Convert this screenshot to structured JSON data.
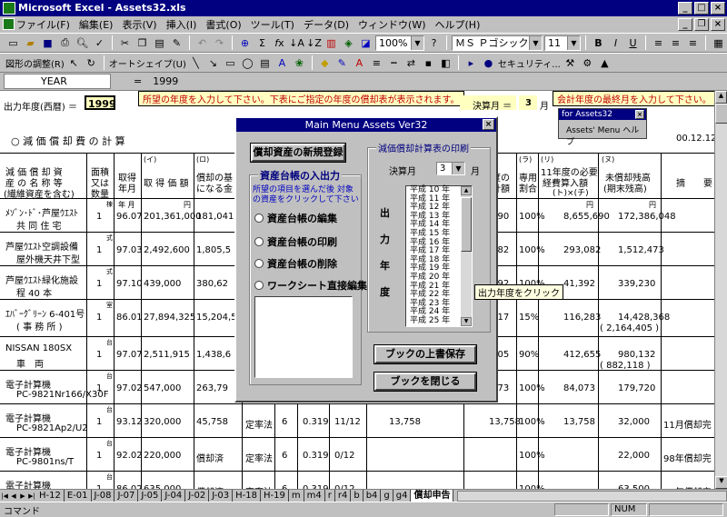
{
  "window": {
    "title": "Microsoft Excel - Assets32.xls"
  },
  "menu": [
    "ファイル(F)",
    "編集(E)",
    "表示(V)",
    "挿入(I)",
    "書式(O)",
    "ツール(T)",
    "データ(D)",
    "ウィンドウ(W)",
    "ヘルプ(H)"
  ],
  "toolbar1": {
    "zoom": "100%",
    "font": "ＭＳ Ｐゴシック",
    "size": "11"
  },
  "toolbar2": {
    "drawing": "図形の調整(R)",
    "autoshape": "オートシェイプ(U)",
    "security": "セキュリティ..."
  },
  "formula_bar": {
    "name_box": "YEAR",
    "equals": "=",
    "value": "1999"
  },
  "sheet": {
    "year_label": "出力年度(西暦) ＝",
    "year_value": "1999",
    "year_note": "所望の年度を入力して下さい。下表にご指定の年度の償却表が表示されます。",
    "month_label": "決算月 ＝",
    "month_value": "3",
    "month_unit": "月",
    "month_note": "会計年度の最終月を入力して下さい。",
    "section_title": "○ 減 価 償 却 費 の 計 算",
    "date": "00.12.12",
    "headers": {
      "h1": "減 価 償 却 資",
      "h1b": "産 の 名 称 等",
      "h1c": "(繊維資産を含む)",
      "h2": "面積",
      "h2b": "又は",
      "h2c": "数量",
      "h3": "取得",
      "h3b": "年月",
      "h4n": "(イ)",
      "h4": "取 得 価 額",
      "h5n": "(ロ)",
      "h5": "償却の基",
      "h5b": "になる金",
      "h6": "度の",
      "h6b": "計額",
      "h7n": "(ラ)",
      "h7": "専用",
      "h7b": "割合",
      "h8n": "(リ)",
      "h8": "11年度の必要",
      "h8b": "経費算入額",
      "h8c": "(ト)×(チ)",
      "h9n": "(ヌ)",
      "h9": "未償却残高",
      "h9b": "(期末残高)",
      "h10": "摘　　要"
    },
    "units": {
      "ym": "年 月",
      "yen1": "円",
      "yen2": "円",
      "yen3": "円"
    },
    "rows": [
      {
        "name": "ﾒｿﾞﾝ･ﾄﾞ･芦屋ｳｴｽﾄ",
        "name2": "共 同 住 宅",
        "unit": "棟",
        "qty": "1",
        "date": "96.07",
        "cost": "201,361,000",
        "base": "181,041,",
        "acc": ",690",
        "ratio": "100%",
        "exp": "8,655,690",
        "rem": "172,386,048",
        "rem2": "",
        "memo": ""
      },
      {
        "name": "芦屋ｳｴｽﾄ空調設備",
        "name2": "屋外機天井下型",
        "unit": "式",
        "qty": "1",
        "date": "97.03",
        "cost": "2,492,600",
        "base": "1,805,5",
        "acc": ",082",
        "ratio": "100%",
        "exp": "293,082",
        "rem": "1,512,473",
        "rem2": "",
        "memo": ""
      },
      {
        "name": "芦屋ｳｴｽﾄ緑化施設",
        "name2": "程 40 本",
        "unit": "式",
        "qty": "1",
        "date": "97.10",
        "cost": "439,000",
        "base": "380,62",
        "acc": ",392",
        "ratio": "100%",
        "exp": "41,392",
        "rem": "339,230",
        "rem2": "",
        "memo": ""
      },
      {
        "name": "ｴﾊﾞｰｸﾞﾘｰﾝ 6-401号",
        "name2": "( 事 務 所 )",
        "unit": "室",
        "qty": "1",
        "date": "86.01",
        "cost": "27,894,325",
        "base": "15,204,5",
        "acc": ",217",
        "ratio": "15%",
        "exp": "116,283",
        "rem": "14,428,368",
        "rem2": "( 2,164,405 )",
        "memo": ""
      },
      {
        "name": "NISSAN 180SX",
        "name2": "車　両",
        "unit": "台",
        "qty": "1",
        "date": "97.07",
        "cost": "2,511,915",
        "base": "1,438,6",
        "acc": ",505",
        "ratio": "90%",
        "exp": "412,655",
        "rem": "980,132",
        "rem2": "( 882,118 )",
        "memo": ""
      },
      {
        "name": "電子計算機",
        "name2": "PC-9821Nr166/X30F",
        "unit": "台",
        "qty": "1",
        "date": "97.02",
        "cost": "547,000",
        "base": "263,79",
        "acc": ",073",
        "ratio": "100%",
        "exp": "84,073",
        "rem": "179,720",
        "rem2": "",
        "memo": ""
      },
      {
        "name": "電子計算機",
        "name2": "PC-9821Ap2/U2",
        "unit": "台",
        "qty": "1",
        "date": "93.12",
        "cost": "320,000",
        "base": "45,758",
        "method": "定率法",
        "life": "6",
        "rate": "0.319",
        "months": "11/12",
        "dep": "13,758",
        "acc": "13,758",
        "ratio": "100%",
        "exp": "13,758",
        "rem": "32,000",
        "rem2": "",
        "memo": "11月償却完"
      },
      {
        "name": "電子計算機",
        "name2": "PC-9801ns/T",
        "unit": "台",
        "qty": "1",
        "date": "92.02",
        "cost": "220,000",
        "base": "償却済",
        "method": "定率法",
        "life": "6",
        "rate": "0.319",
        "months": "0/12",
        "dep": "",
        "acc": "",
        "ratio": "100%",
        "exp": "",
        "rem": "22,000",
        "rem2": "",
        "memo": "98年償却完"
      },
      {
        "name": "電子計算機",
        "name2": "",
        "unit": "台",
        "qty": "1",
        "date": "86.02",
        "cost": "635,000",
        "base": "償却済",
        "method": "定率法",
        "life": "6",
        "rate": "0.319",
        "months": "0/12",
        "dep": "",
        "acc": "",
        "ratio": "100%",
        "exp": "",
        "rem": "63,500",
        "rem2": "",
        "memo": "92年償却完"
      }
    ]
  },
  "dialog": {
    "title": "Main Menu   Assets Ver32",
    "new_btn": "償却資産の新規登録",
    "group1": "資産台帳の入出力",
    "group1_hint": "所望の項目を選んだ後 対象の資産をクリックして下さい",
    "opt_edit": "資産台帳の編集",
    "opt_print": "資産台帳の印刷",
    "opt_delete": "資産台帳の削除",
    "opt_direct": "ワークシート直接編集",
    "group2": "減価償却計算表の印刷",
    "month_label": "決算月",
    "month_value": "3",
    "month_unit": "月",
    "output_label": [
      "出",
      "力",
      "年",
      "度"
    ],
    "years": [
      "平成 10 年",
      "平成 11 年",
      "平成 12 年",
      "平成 13 年",
      "平成 14 年",
      "平成 15 年",
      "平成 16 年",
      "平成 17 年",
      "平成 18 年",
      "平成 19 年",
      "平成 20 年",
      "平成 21 年",
      "平成 22 年",
      "平成 23 年",
      "平成 24 年",
      "平成 25 年"
    ],
    "save_btn": "ブックの上書保存",
    "close_btn": "ブックを閉じる",
    "tooltip": "出力年度をクリック"
  },
  "palette": {
    "title": "for Assets32",
    "item": "Assets' Menu ヘルプ"
  },
  "tabs": [
    "H-12",
    "E-01",
    "J-08",
    "J-07",
    "J-05",
    "J-04",
    "J-02",
    "J-03",
    "H-18",
    "H-19",
    "m",
    "m4",
    "r",
    "r4",
    "b",
    "b4",
    "g",
    "g4",
    "償却申告"
  ],
  "status": {
    "mode": "コマンド",
    "num": "NUM"
  }
}
